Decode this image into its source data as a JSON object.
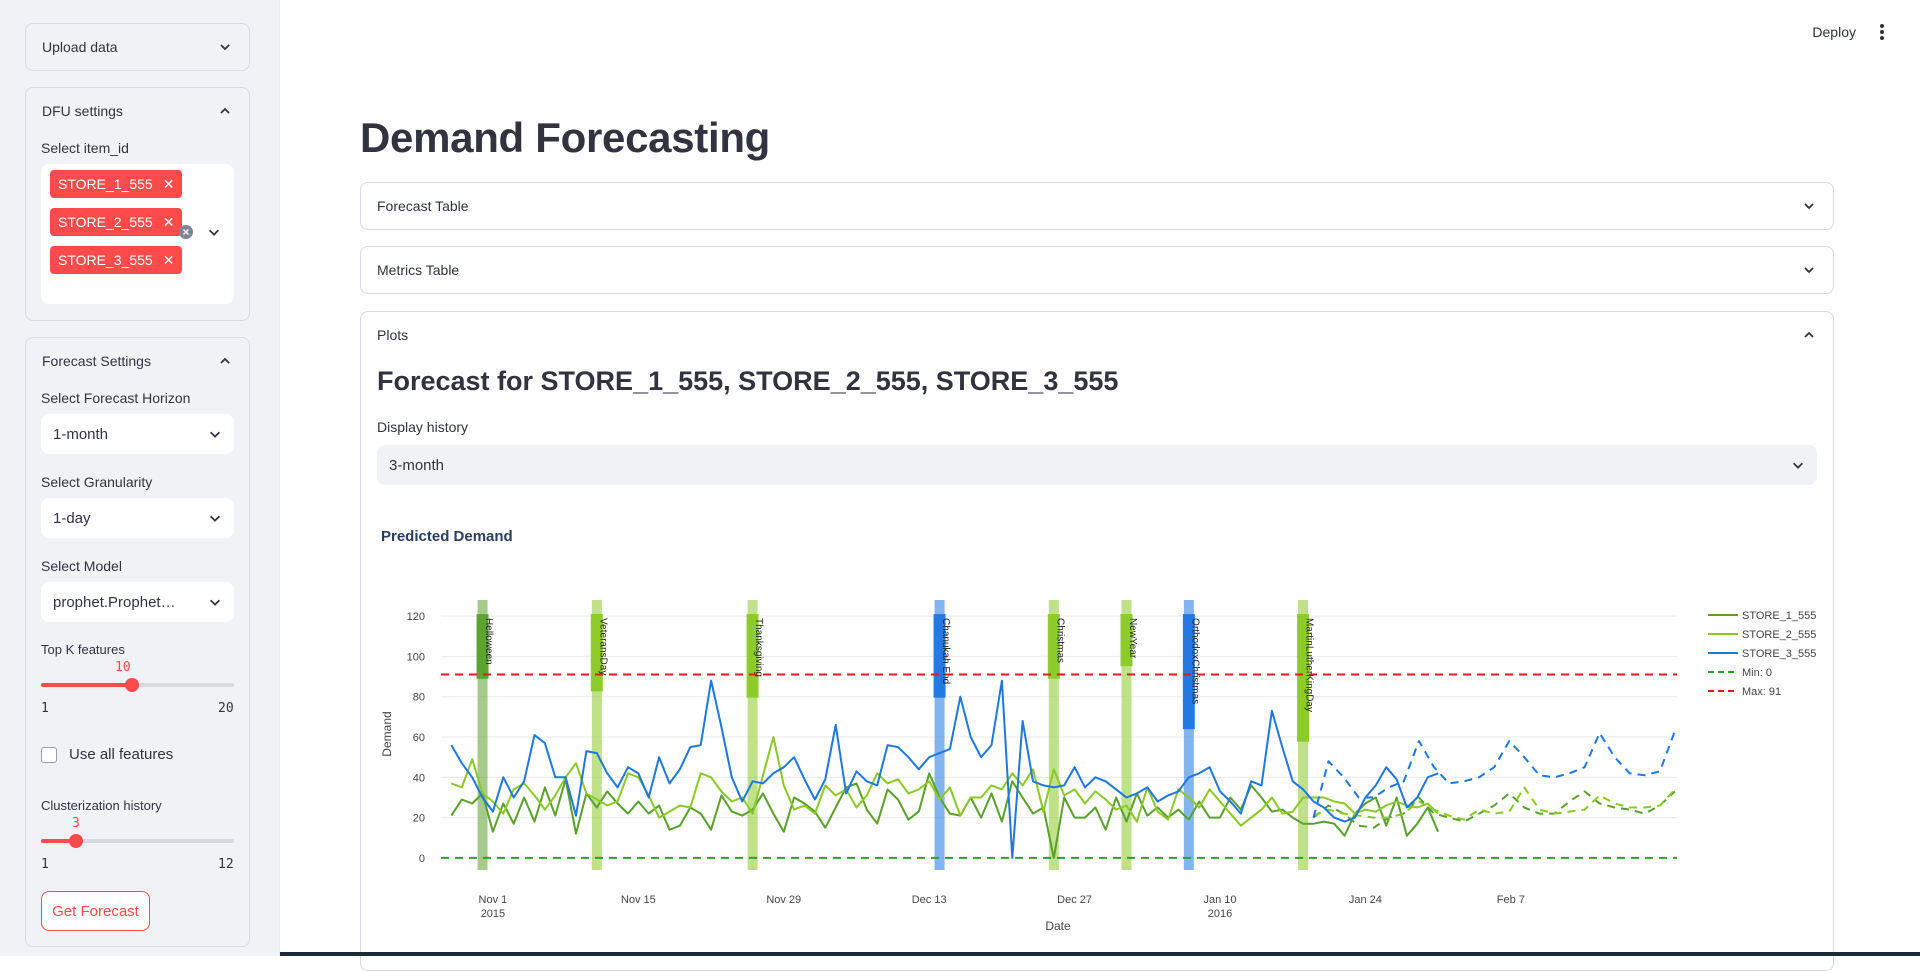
{
  "toolbar": {
    "deploy_label": "Deploy",
    "menu_icon": "kebab-icon"
  },
  "sidebar": {
    "upload": {
      "title": "Upload data"
    },
    "dfu": {
      "title": "DFU settings",
      "select_label": "Select item_id",
      "selected": [
        "STORE_1_555",
        "STORE_2_555",
        "STORE_3_555"
      ]
    },
    "forecast_settings": {
      "title": "Forecast Settings",
      "horizon_label": "Select Forecast Horizon",
      "horizon_value": "1-month",
      "granularity_label": "Select Granularity",
      "granularity_value": "1-day",
      "model_label": "Select Model",
      "model_value": "prophet.Prophet…",
      "topk_label": "Top K features",
      "topk_value": "10",
      "topk_value_num": 10,
      "topk_min": "1",
      "topk_max": "20",
      "use_all_label": "Use all features",
      "use_all_checked": false,
      "cluster_label": "Clusterization history",
      "cluster_value": "3",
      "cluster_value_num": 3,
      "cluster_min": "1",
      "cluster_max": "12",
      "get_forecast_label": "Get Forecast"
    }
  },
  "main": {
    "title": "Demand Forecasting",
    "expanders": {
      "forecast_table": "Forecast Table",
      "metrics_table": "Metrics Table",
      "plots": "Plots"
    },
    "plots": {
      "subheader": "Forecast for STORE_1_555, STORE_2_555, STORE_3_555",
      "history_label": "Display history",
      "history_value": "3-month"
    }
  },
  "chart_data": {
    "type": "line",
    "title": "Predicted Demand",
    "xlabel": "Date",
    "ylabel": "Demand",
    "ylim": [
      -6,
      128
    ],
    "xlim": [
      "2015-10-27",
      "2016-02-23"
    ],
    "y_ticks": [
      0,
      20,
      40,
      60,
      80,
      100,
      120
    ],
    "x_ticks": [
      {
        "date": "2015-11-01",
        "label": "Nov 1",
        "sub": "2015"
      },
      {
        "date": "2015-11-15",
        "label": "Nov 15",
        "sub": ""
      },
      {
        "date": "2015-11-29",
        "label": "Nov 29",
        "sub": ""
      },
      {
        "date": "2015-12-13",
        "label": "Dec 13",
        "sub": ""
      },
      {
        "date": "2015-12-27",
        "label": "Dec 27",
        "sub": ""
      },
      {
        "date": "2016-01-10",
        "label": "Jan 10",
        "sub": "2016"
      },
      {
        "date": "2016-01-24",
        "label": "Jan 24",
        "sub": ""
      },
      {
        "date": "2016-02-07",
        "label": "Feb 7",
        "sub": ""
      }
    ],
    "start_date": "2015-10-28",
    "forecast_start_date": "2016-01-19",
    "legend_position": "right",
    "grid": true,
    "series": [
      {
        "name": "STORE_1_555",
        "color": "#5aa02c",
        "history": [
          21,
          29,
          27,
          32,
          13,
          27,
          17,
          30,
          18,
          35,
          21,
          39,
          12,
          32,
          25,
          33,
          27,
          22,
          28,
          22,
          26,
          14,
          16,
          25,
          22,
          14,
          31,
          23,
          21,
          24,
          32,
          22,
          13,
          30,
          27,
          23,
          15,
          25,
          35,
          37,
          24,
          17,
          34,
          29,
          19,
          23,
          42,
          30,
          22,
          21,
          30,
          20,
          32,
          18,
          38,
          30,
          22,
          25,
          0,
          30,
          20,
          20,
          25,
          14,
          30,
          18,
          32,
          21,
          25,
          20,
          24,
          19,
          28,
          20,
          20,
          30,
          24,
          36,
          30,
          23,
          24,
          20,
          17,
          17,
          18,
          17,
          11,
          22,
          27,
          30,
          16,
          30,
          11,
          17,
          25,
          13
        ],
        "forecast": [
          20,
          26,
          22,
          16,
          15,
          20,
          22,
          30,
          22,
          20,
          18,
          22,
          26,
          32,
          25,
          22,
          22,
          28,
          33,
          27,
          25,
          24,
          22,
          26,
          33
        ]
      },
      {
        "name": "STORE_2_555",
        "color": "#8ac926",
        "history": [
          37,
          35,
          49,
          32,
          28,
          22,
          34,
          37,
          31,
          24,
          31,
          40,
          47,
          32,
          29,
          26,
          28,
          42,
          40,
          31,
          20,
          23,
          26,
          25,
          42,
          40,
          33,
          28,
          30,
          22,
          41,
          60,
          36,
          24,
          26,
          22,
          36,
          31,
          34,
          25,
          31,
          42,
          37,
          39,
          32,
          34,
          38,
          29,
          35,
          21,
          30,
          30,
          36,
          34,
          42,
          36,
          44,
          23,
          44,
          31,
          34,
          27,
          33,
          29,
          24,
          26,
          18,
          35,
          23,
          19,
          34,
          30,
          25,
          34,
          28,
          22,
          16,
          20,
          24,
          30,
          22,
          23,
          30,
          30,
          30,
          28,
          27,
          22,
          24,
          23,
          26,
          28,
          26,
          25,
          27,
          22
        ],
        "forecast": [
          21,
          24,
          22,
          21,
          20,
          20,
          22,
          28,
          24,
          21,
          19,
          24,
          22,
          23,
          35,
          24,
          22,
          23,
          24,
          31,
          27,
          25,
          25,
          26,
          34
        ]
      },
      {
        "name": "STORE_3_555",
        "color": "#1f77e0",
        "history": [
          56,
          47,
          40,
          30,
          23,
          40,
          30,
          38,
          61,
          57,
          40,
          40,
          21,
          53,
          52,
          42,
          35,
          45,
          42,
          30,
          50,
          37,
          44,
          55,
          56,
          88,
          65,
          40,
          28,
          38,
          37,
          42,
          45,
          50,
          39,
          29,
          39,
          66,
          32,
          43,
          38,
          36,
          56,
          55,
          50,
          44,
          50,
          52,
          54,
          80,
          60,
          50,
          56,
          88,
          0,
          68,
          38,
          36,
          35,
          36,
          45,
          35,
          40,
          38,
          34,
          30,
          32,
          35,
          28,
          31,
          33,
          40,
          42,
          45,
          33,
          28,
          22,
          38,
          36,
          73,
          55,
          38,
          34,
          28,
          25,
          20,
          18,
          20,
          30,
          36,
          45,
          39,
          25,
          30,
          40,
          42
        ],
        "forecast": [
          20,
          48,
          40,
          30,
          30,
          35,
          38,
          58,
          45,
          37,
          38,
          40,
          45,
          58,
          50,
          41,
          40,
          42,
          45,
          62,
          50,
          42,
          41,
          43,
          63
        ]
      }
    ],
    "reference_lines": [
      {
        "name": "Min: 0",
        "value": 0,
        "color": "#2ca02c"
      },
      {
        "name": "Max: 91",
        "value": 91,
        "color": "#e31a1c"
      }
    ],
    "events": [
      {
        "name": "Helloween",
        "date": "2015-10-31",
        "color": "#5aa02c"
      },
      {
        "name": "VeteransDay",
        "date": "2015-11-11",
        "color": "#8ac926"
      },
      {
        "name": "Thanksgiving",
        "date": "2015-11-26",
        "color": "#8ac926"
      },
      {
        "name": "Chanukah End",
        "date": "2015-12-14",
        "color": "#1f77e0"
      },
      {
        "name": "Christmas",
        "date": "2015-12-25",
        "color": "#8ac926"
      },
      {
        "name": "NewYear",
        "date": "2016-01-01",
        "color": "#8ac926"
      },
      {
        "name": "OrthodoxChristmas",
        "date": "2016-01-07",
        "color": "#1f77e0"
      },
      {
        "name": "MartinLutherKingDay",
        "date": "2016-01-18",
        "color": "#8ac926"
      }
    ]
  }
}
